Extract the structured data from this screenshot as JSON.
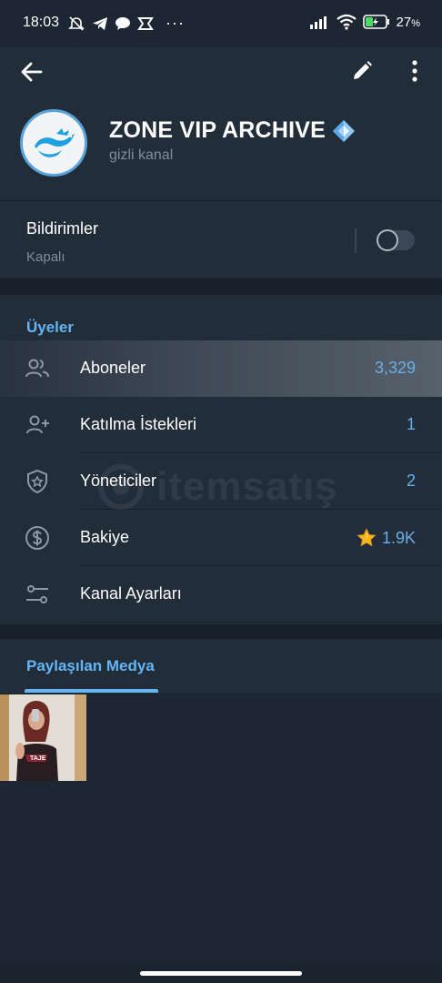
{
  "status_bar": {
    "time": "18:03",
    "battery_percent": "27",
    "battery_suffix": "%",
    "left_icons": [
      "alarm-off-icon",
      "telegram-icon",
      "chat-bubble-icon",
      "capcut-icon",
      "more-dots-icon"
    ],
    "right_icons": [
      "signal-icon",
      "wifi-icon",
      "battery-charging-icon"
    ]
  },
  "header": {
    "channel_name": "ZONE VIP ARCHIVE",
    "channel_type": "gizli kanal",
    "icons": {
      "back": "arrow-back-icon",
      "edit": "pencil-icon",
      "more": "more-vertical-icon",
      "badge": "diamond-emoji-icon"
    }
  },
  "notifications": {
    "title": "Bildirimler",
    "status": "Kapalı",
    "enabled": false
  },
  "members": {
    "section_title": "Üyeler",
    "rows": [
      {
        "label": "Aboneler",
        "value": "3,329",
        "icon": "people-icon",
        "highlighted": true
      },
      {
        "label": "Katılma İstekleri",
        "value": "1",
        "icon": "add-person-icon"
      },
      {
        "label": "Yöneticiler",
        "value": "2",
        "icon": "shield-star-icon"
      },
      {
        "label": "Bakiye",
        "value": "1.9K",
        "value_icon": "star-emoji-icon",
        "icon": "dollar-circle-icon"
      },
      {
        "label": "Kanal Ayarları",
        "value": "",
        "icon": "sliders-icon"
      }
    ]
  },
  "watermark": {
    "text": "itemsatış"
  },
  "media": {
    "tab_label": "Paylaşılan Medya",
    "items": [
      {
        "type": "photo"
      }
    ]
  },
  "colors": {
    "background": "#1d2733",
    "surface": "#222d3a",
    "accent": "#64b5f6",
    "value_text": "#6aaee8",
    "secondary_text": "#7f8d9b"
  }
}
